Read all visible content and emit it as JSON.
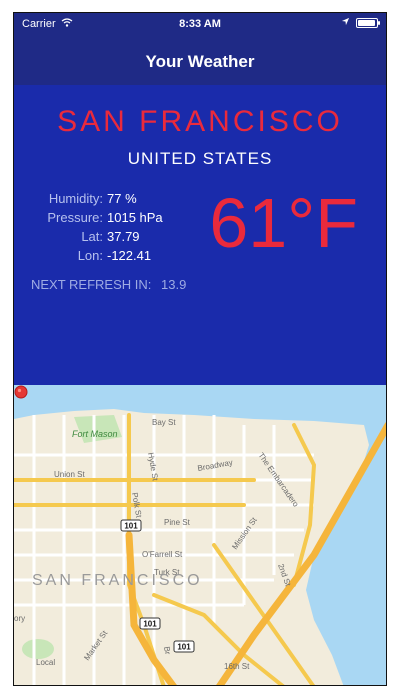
{
  "status_bar": {
    "carrier": "Carrier",
    "time": "8:33 AM",
    "battery_level": 0.95
  },
  "navbar": {
    "title": "Your Weather"
  },
  "weather": {
    "city": "SAN FRANCISCO",
    "country": "UNITED STATES",
    "stats": [
      {
        "label": "Humidity:",
        "value": "77 %"
      },
      {
        "label": "Pressure:",
        "value": "1015 hPa"
      },
      {
        "label": "Lat:",
        "value": "37.79"
      },
      {
        "label": "Lon:",
        "value": "-122.41"
      }
    ],
    "temperature": "61°F",
    "refresh": {
      "label": "NEXT REFRESH IN:",
      "value": "13.9"
    }
  },
  "map": {
    "labels": {
      "fort_mason": "Fort Mason",
      "bay_st": "Bay St",
      "union_st": "Union St",
      "broadway": "Broadway",
      "polk_st": "Polk St",
      "hyde_st": "Hyde St",
      "pine_st": "Pine St",
      "ofarrell_st": "O'Farrell St",
      "turk_st": "Turk St",
      "mission_st": "Mission St",
      "embarcadero": "The Embarcadero",
      "second_st": "2nd St",
      "sixteenth_st": "16th St",
      "market_st": "Market St",
      "city_watermark": "SAN FRANCISCO",
      "ory": "ory",
      "local": "Local",
      "br": "Br"
    },
    "highway_shields": [
      "101",
      "101",
      "101"
    ]
  },
  "colors": {
    "status_nav_bg": "#1f2a86",
    "content_bg": "#1a2bab",
    "accent_red": "#ea2a3c",
    "map_land": "#f2ecdc",
    "map_water": "#a9d7f3",
    "map_highway": "#f5c94e"
  }
}
